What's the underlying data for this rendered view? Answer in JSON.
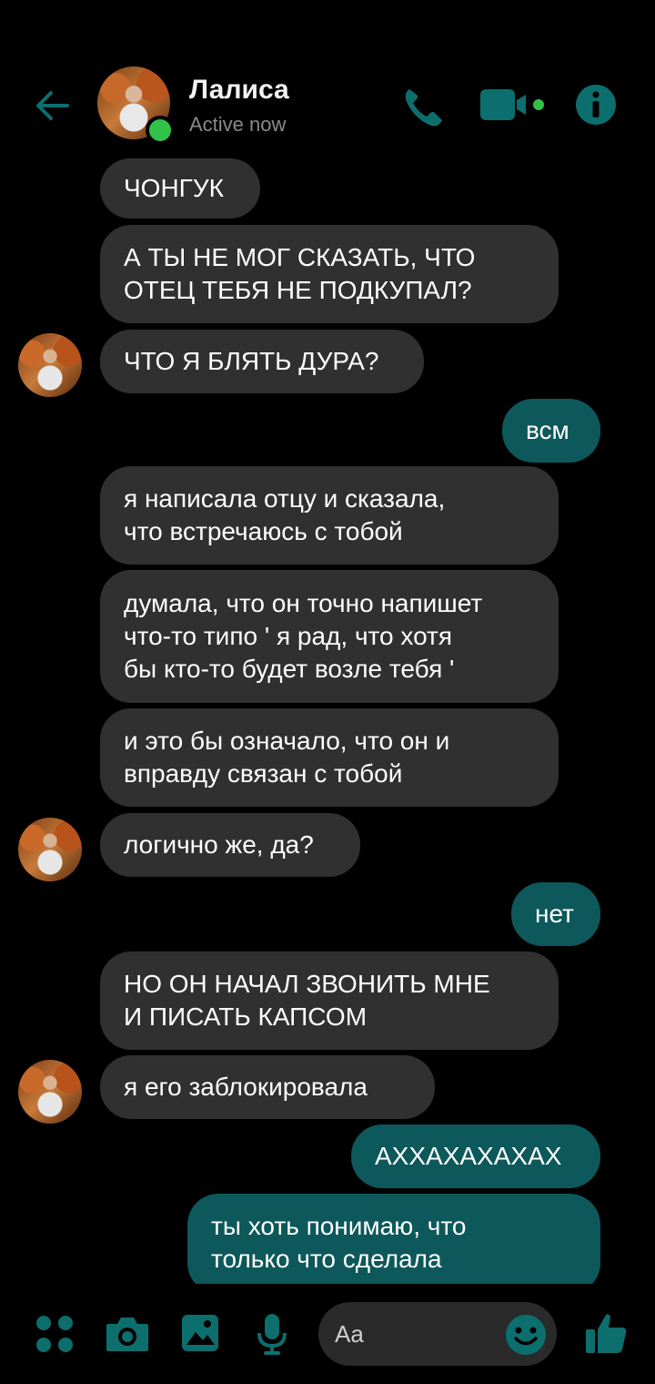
{
  "header": {
    "contact_name": "Лалиса",
    "status": "Active now",
    "accent_color": "#0d585a",
    "icons": [
      "back-arrow-icon",
      "phone-icon",
      "video-camera-icon",
      "info-icon"
    ]
  },
  "messages": [
    {
      "from": "contact",
      "text": "ЧОНГУК"
    },
    {
      "from": "contact",
      "text": "А ТЫ НЕ МОГ СКАЗАТЬ, ЧТО\nОТЕЦ ТЕБЯ НЕ ПОДКУПАЛ?"
    },
    {
      "from": "contact",
      "text": "ЧТО Я БЛЯТЬ ДУРА?"
    },
    {
      "from": "me",
      "text": "всм"
    },
    {
      "from": "contact",
      "text": "я написала отцу и сказала,\nчто встречаюсь с тобой"
    },
    {
      "from": "contact",
      "text": "думала, что он точно напишет\nчто-то типо ' я рад, что хотя\nбы кто-то будет возле тебя '"
    },
    {
      "from": "contact",
      "text": "и это бы означало, что он и\nвправду связан с тобой"
    },
    {
      "from": "contact",
      "text": "логично же, да?"
    },
    {
      "from": "me",
      "text": "нет"
    },
    {
      "from": "contact",
      "text": "НО ОН НАЧАЛ ЗВОНИТЬ МНЕ\nИ ПИСАТЬ КАПСОМ"
    },
    {
      "from": "contact",
      "text": "я его заблокировала"
    },
    {
      "from": "me",
      "text": "АХХАХАХАХАХ"
    },
    {
      "from": "me",
      "text": "ты хоть понимаю, что\nтолько что сделала"
    }
  ],
  "composer": {
    "placeholder": "Aa",
    "icons": [
      "menu-dots-icon",
      "camera-icon",
      "gallery-icon",
      "microphone-icon",
      "emoji-icon",
      "thumbs-up-icon"
    ]
  }
}
